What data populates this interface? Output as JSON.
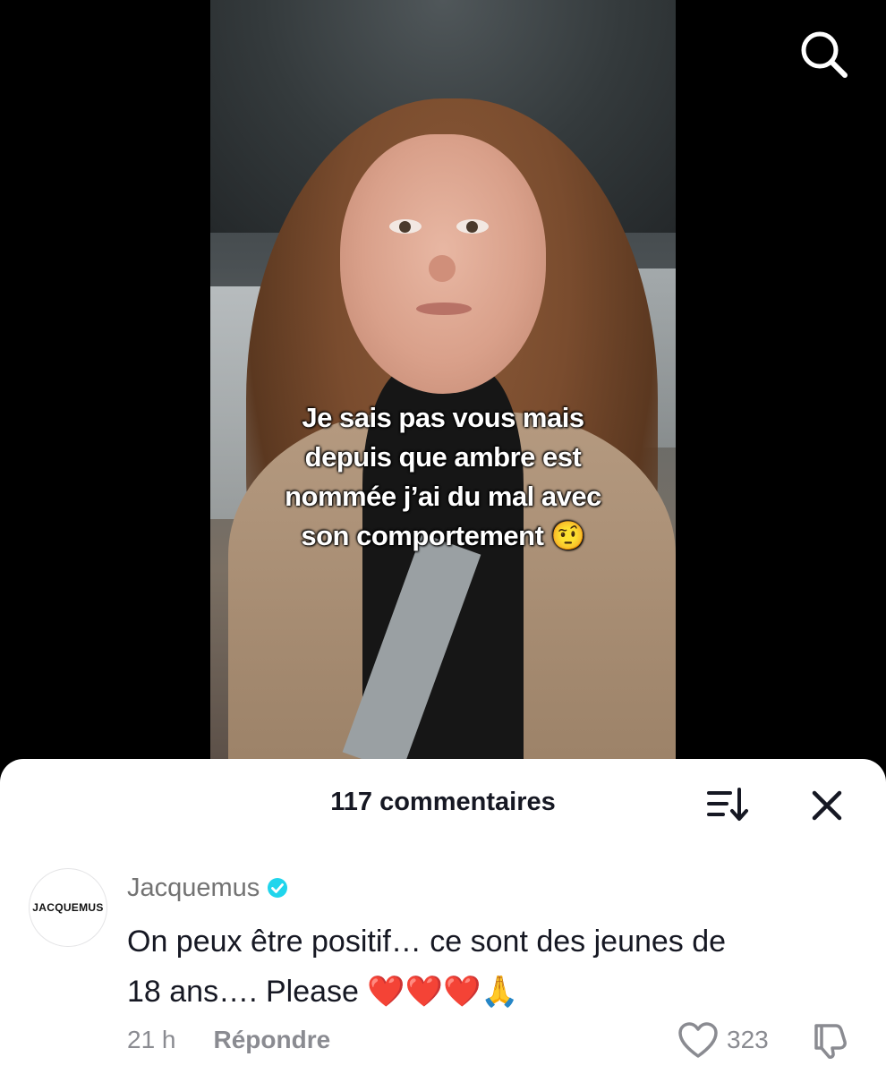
{
  "video": {
    "caption_lines": [
      "Je sais pas vous mais",
      "depuis que ambre est",
      "nommée j’ai du mal avec",
      "son comportement 🤨"
    ],
    "search_icon": "search-icon"
  },
  "comments_sheet": {
    "title": "117 commentaires",
    "sort_icon": "sort-icon",
    "close_icon": "close-icon"
  },
  "comment": {
    "avatar_text": "JACQUEMUS",
    "author": "Jacquemus",
    "verified": true,
    "verified_color": "#20d5ec",
    "line1": "On peux être positif… ce sont des jeunes de",
    "line2": "18 ans…. Please ❤️❤️❤️🙏",
    "time": "21 h",
    "reply_label": "Répondre",
    "like_count": "323",
    "like_icon": "heart-icon",
    "dislike_icon": "thumbs-down-icon"
  }
}
